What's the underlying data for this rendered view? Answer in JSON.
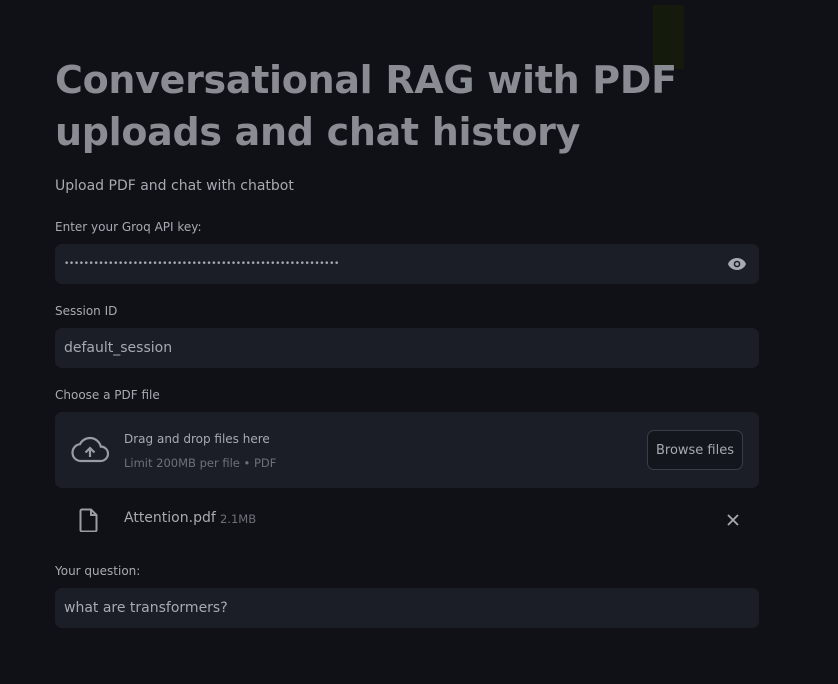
{
  "app": {
    "title": "Conversational RAG with PDF uploads and chat history",
    "subtitle": "Upload PDF and chat with chatbot"
  },
  "api_key": {
    "label": "Enter your Groq API key:",
    "masked_value": "••••••••••••••••••••••••••••••••••••••••••••••••••••••••",
    "toggle_icon": "eye-icon"
  },
  "session": {
    "label": "Session ID",
    "value": "default_session"
  },
  "uploader": {
    "label": "Choose a PDF file",
    "drop_text": "Drag and drop files here",
    "limit_text": "Limit 200MB per file • PDF",
    "browse_label": "Browse files",
    "icon": "cloud-upload-icon"
  },
  "uploaded_file": {
    "name": "Attention.pdf",
    "size": "2.1MB",
    "icon": "file-icon",
    "remove_icon": "close-icon"
  },
  "question": {
    "label": "Your question:",
    "value": "what are transformers?"
  },
  "colors": {
    "background": "#0f1117",
    "input_bg": "#1b1e26",
    "title": "#8a8c93",
    "text": "#a8aab1",
    "muted": "#6d7078"
  }
}
